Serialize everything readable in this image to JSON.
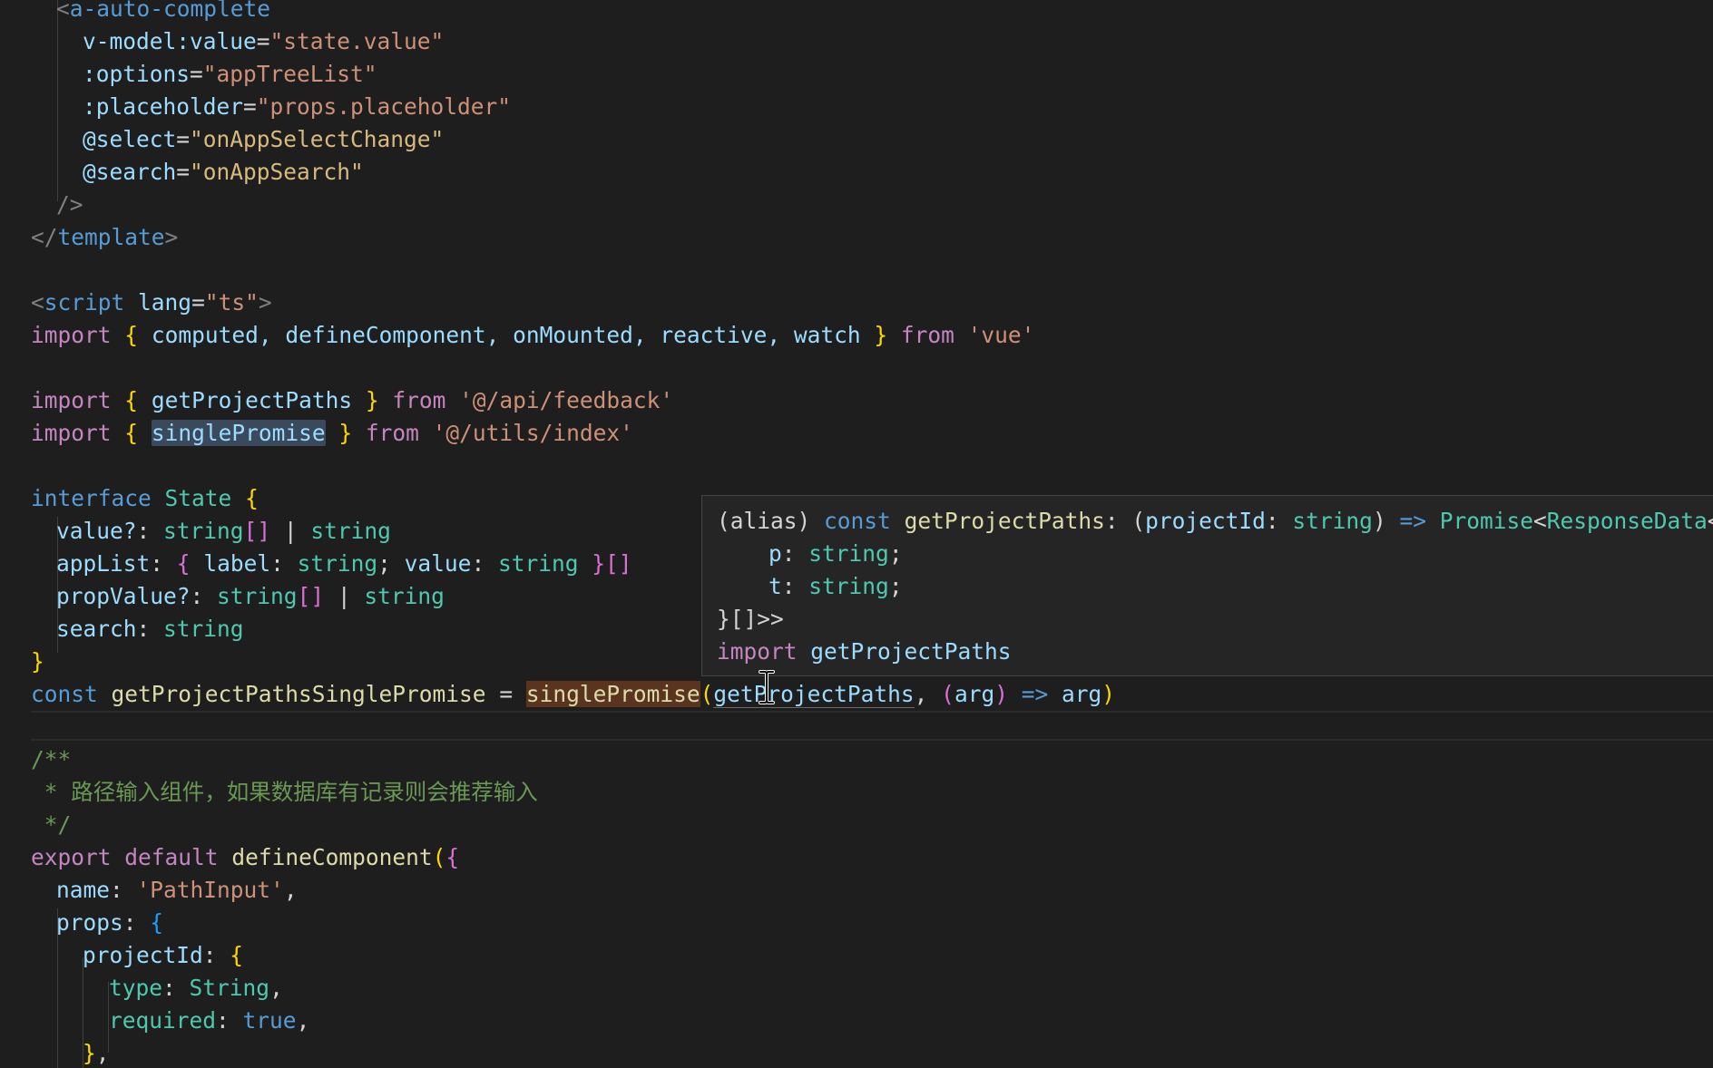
{
  "code": {
    "l1": {
      "lt": "<",
      "tag": "a-auto-complete"
    },
    "l2": {
      "attr": "v-model:value",
      "eq": "=",
      "val": "\"state.value\""
    },
    "l3": {
      "attr": ":options",
      "eq": "=",
      "val": "\"appTreeList\""
    },
    "l4": {
      "attr": ":placeholder",
      "eq": "=",
      "val": "\"props.placeholder\""
    },
    "l5": {
      "attr": "@select",
      "eq": "=",
      "val": "\"onAppSelectChange\""
    },
    "l6": {
      "attr": "@search",
      "eq": "=",
      "val": "\"onAppSearch\""
    },
    "l7": {
      "close": "/>"
    },
    "l8": {
      "open": "</",
      "tag": "template",
      "close": ">"
    },
    "l10": {
      "open": "<",
      "tag": "script",
      "attr": "lang",
      "eq": "=",
      "val": "\"ts\"",
      "close": ">"
    },
    "l11": {
      "kw": "import",
      "b1": "{",
      "names": "computed, defineComponent, onMounted, reactive, watch",
      "b2": "}",
      "from": "from",
      "src": "'vue'"
    },
    "l13": {
      "kw": "import",
      "b1": "{",
      "name": "getProjectPaths",
      "b2": "}",
      "from": "from",
      "src": "'@/api/feedback'"
    },
    "l14": {
      "kw": "import",
      "b1": "{",
      "name": "singlePromise",
      "b2": "}",
      "from": "from",
      "src": "'@/utils/index'"
    },
    "l16": {
      "kw": "interface",
      "name": "State",
      "b": "{"
    },
    "l17": {
      "prop": "value?",
      "colon": ":",
      "t1": "string",
      "arr": "[]",
      "bar": "|",
      "t2": "string"
    },
    "l18": {
      "prop": "appList",
      "colon": ":",
      "b1": "{",
      "p1": "label",
      "c1": ":",
      "t1": "string",
      "semi": ";",
      "p2": "value",
      "c2": ":",
      "t2": "string",
      "b2": "}",
      "arr": "[]"
    },
    "l19": {
      "prop": "propValue?",
      "colon": ":",
      "t1": "string",
      "arr": "[]",
      "bar": "|",
      "t2": "string"
    },
    "l20": {
      "prop": "search",
      "colon": ":",
      "t1": "string"
    },
    "l21": {
      "b": "}"
    },
    "l22": {
      "kw": "const",
      "name": "getProjectPathsSinglePromise",
      "eq": "=",
      "fn": "singlePromise",
      "p1": "(",
      "arg1": "getProjectPaths",
      "comma": ",",
      "p2": "(",
      "arg": "arg",
      "p3": ")",
      "arrow": "=>",
      "ret": "arg",
      "p4": ")"
    },
    "l24": {
      "text": "/**"
    },
    "l25": {
      "text": " * 路径输入组件，如果数据库有记录则会推荐输入"
    },
    "l26": {
      "text": " */"
    },
    "l27": {
      "kw1": "export",
      "kw2": "default",
      "fn": "defineComponent",
      "p": "(",
      "b": "{"
    },
    "l28": {
      "prop": "name",
      "colon": ":",
      "val": "'PathInput'",
      "comma": ","
    },
    "l29": {
      "prop": "props",
      "colon": ":",
      "b": "{"
    },
    "l30": {
      "prop": "projectId",
      "colon": ":",
      "b": "{"
    },
    "l31": {
      "prop": "type",
      "colon": ":",
      "val": "String",
      "comma": ","
    },
    "l32": {
      "prop": "required",
      "colon": ":",
      "val": "true",
      "comma": ","
    },
    "l33": {
      "b": "}",
      "comma": ","
    }
  },
  "hover": {
    "h1": {
      "alias": "(alias)",
      "kw": "const",
      "name": "getProjectPaths",
      "colon": ":",
      "p1": "(",
      "param": "projectId",
      "c2": ":",
      "ptype": "string",
      "p2": ")",
      "arrow": "=>",
      "promise": "Promise",
      "lt": "<",
      "rd": "ResponseData",
      "lt2": "<{"
    },
    "h2": {
      "prop": "p",
      "colon": ":",
      "type": "string",
      "semi": ";"
    },
    "h3": {
      "prop": "t",
      "colon": ":",
      "type": "string",
      "semi": ";"
    },
    "h4": {
      "text": "}[]>>"
    },
    "h5": {
      "kw": "import",
      "name": "getProjectPaths"
    }
  },
  "colors": {
    "background": "#1e1e1e",
    "hover_background": "#252526",
    "selection": "#3a4a5c",
    "highlight": "#5b3420"
  },
  "icons": {
    "cursor": "text-cursor-icon"
  }
}
